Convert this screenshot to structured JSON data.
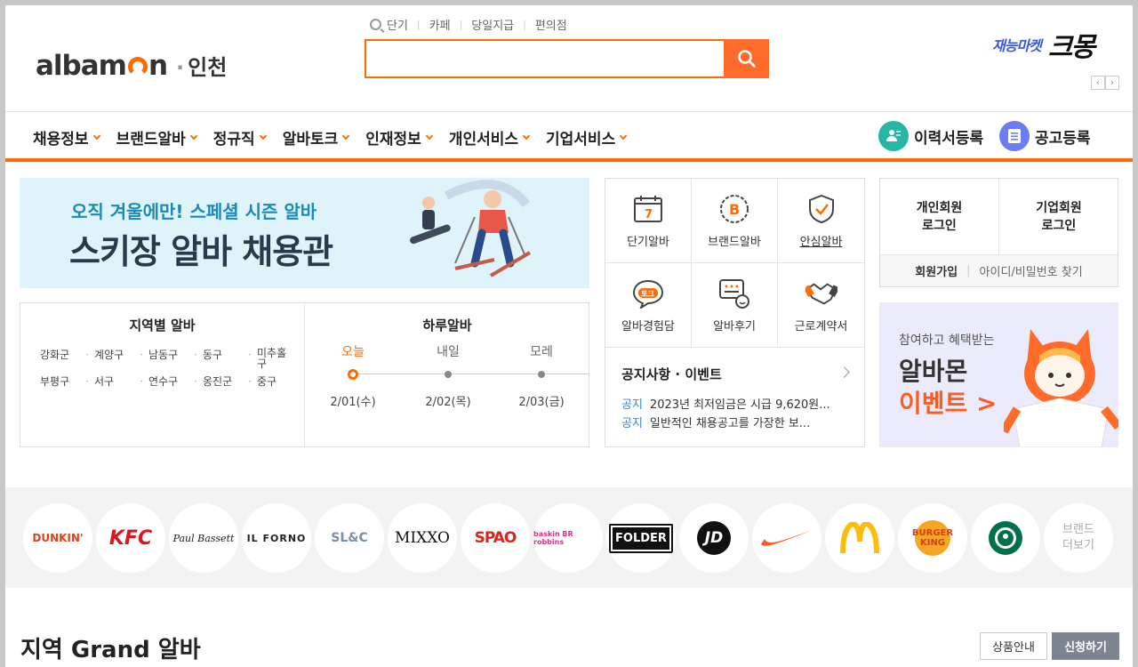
{
  "header": {
    "logo_word": "albamon",
    "region": "인천",
    "quick_links": [
      "단기",
      "카페",
      "당일지급",
      "편의점"
    ],
    "search_placeholder": "",
    "ad": {
      "sub": "재능마켓",
      "main": "크몽"
    }
  },
  "gnb": {
    "menu": [
      "채용정보",
      "브랜드알바",
      "정규직",
      "알바토크",
      "인재정보",
      "개인서비스",
      "기업서비스"
    ],
    "resume": "이력서등록",
    "post": "공고등록"
  },
  "banner": {
    "sub": "오직 겨울에만! 스페셜 시즌 알바",
    "main": "스키장 알바 채용관"
  },
  "region_box": {
    "title": "지역별 알바",
    "regions": [
      "강화군",
      "계양구",
      "남동구",
      "동구",
      "미추홀구",
      "부평구",
      "서구",
      "연수구",
      "옹진군",
      "중구"
    ]
  },
  "daily": {
    "title": "하루알바",
    "days": [
      {
        "label": "오늘",
        "date": "2/01(수)"
      },
      {
        "label": "내일",
        "date": "2/02(목)"
      },
      {
        "label": "모레",
        "date": "2/03(금)"
      }
    ]
  },
  "services": [
    "단기알바",
    "브랜드알바",
    "안심알바",
    "알바경험담",
    "알바후기",
    "근로계약서"
  ],
  "notice": {
    "title": "공지사항 · 이벤트",
    "items": [
      {
        "tag": "공지",
        "text": "2023년 최저임금은 시급 9,620원..."
      },
      {
        "tag": "공지",
        "text": "일반적인 채용공고를 가장한 보..."
      }
    ]
  },
  "login": {
    "personal": "개인회원\n로그인",
    "company": "기업회원\n로그인",
    "join": "회원가입",
    "find": "아이디/비밀번호 찾기"
  },
  "event": {
    "sub": "참여하고 혜택받는",
    "main1": "알바몬",
    "main2": "이벤트 >"
  },
  "brands": [
    "DUNKIN'",
    "KFC",
    "Paul Bassett",
    "IL FORNO",
    "SL&C",
    "MIXXO",
    "SPAO",
    "baskin BR robbins",
    "FOLDER",
    "JD",
    "Nike",
    "McDonald's",
    "BURGER KING",
    "Starbucks"
  ],
  "brand_more": "브랜드\n더보기",
  "grand": {
    "title": "지역 Grand 알바",
    "info_btn": "상품안내",
    "apply_btn": "신청하기"
  },
  "colors": {
    "accent": "#ff6b00",
    "link_blue": "#3a86d4",
    "resume_icon": "#27b5a5",
    "post_icon": "#6c7cf2"
  }
}
